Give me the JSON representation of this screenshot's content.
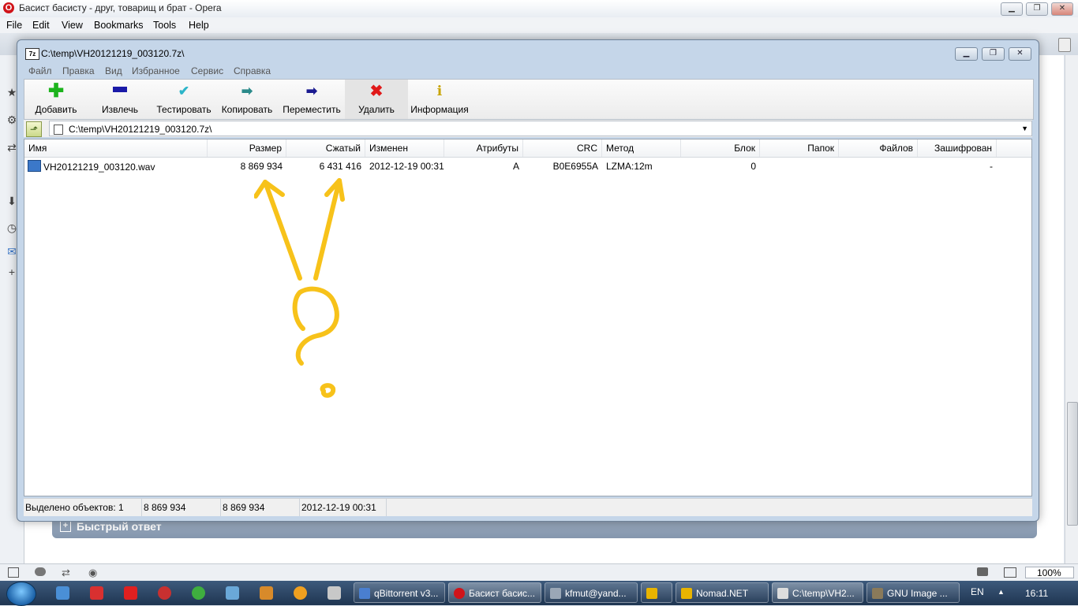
{
  "opera": {
    "title": "Басист басисту - друг, товарищ и брат - Opera",
    "menu": [
      "File",
      "Edit",
      "View",
      "Bookmarks",
      "Tools",
      "Help"
    ],
    "quick_reply": "Быстрый ответ",
    "zoom": "100%"
  },
  "zip": {
    "title": "C:\\temp\\VH20121219_003120.7z\\",
    "menu": [
      "Файл",
      "Правка",
      "Вид",
      "Избранное",
      "Сервис",
      "Справка"
    ],
    "toolbar": [
      {
        "label": "Добавить",
        "icon": "plus-icon",
        "color": "#1db31d"
      },
      {
        "label": "Извлечь",
        "icon": "minus-icon",
        "color": "#1a1aa8"
      },
      {
        "label": "Тестировать",
        "icon": "check-icon",
        "color": "#2cb5c9"
      },
      {
        "label": "Копировать",
        "icon": "copy-arrow-icon",
        "color": "#2a8a8a"
      },
      {
        "label": "Переместить",
        "icon": "move-arrow-icon",
        "color": "#1a1a90"
      },
      {
        "label": "Удалить",
        "icon": "delete-x-icon",
        "color": "#e01818"
      },
      {
        "label": "Информация",
        "icon": "info-icon",
        "color": "#c8a400"
      }
    ],
    "address": "C:\\temp\\VH20121219_003120.7z\\",
    "columns": [
      "Имя",
      "Размер",
      "Сжатый",
      "Изменен",
      "Атрибуты",
      "CRC",
      "Метод",
      "Блок",
      "Папок",
      "Файлов",
      "Зашифрован"
    ],
    "rows": [
      {
        "name": "VH20121219_003120.wav",
        "size": "8 869 934",
        "packed": "6 431 416",
        "modified": "2012-12-19 00:31",
        "attributes": "A",
        "crc": "B0E6955A",
        "method": "LZMA:12m",
        "block": "0",
        "folders": "",
        "files": "",
        "encrypted": "-"
      }
    ],
    "status": {
      "selected": "Выделено объектов: 1",
      "size": "8 869 934",
      "packed": "8 869 934",
      "modified": "2012-12-19 00:31"
    },
    "annotation_color": "#f7c21a"
  },
  "taskbar": {
    "tasks": [
      {
        "label": "qBittorrent v3...",
        "color": "#4a7fcf"
      },
      {
        "label": "Басист басис...",
        "color": "#d0141a",
        "active": true
      },
      {
        "label": "kfmut@yand...",
        "color": "#9aa7b6"
      },
      {
        "label": "",
        "color": "#e8b400"
      },
      {
        "label": "Nomad.NET",
        "color": "#e8b400"
      },
      {
        "label": "C:\\temp\\VH2...",
        "color": "#dddddd",
        "active": true
      },
      {
        "label": "GNU Image ...",
        "color": "#8a7a5a"
      }
    ],
    "lang": "EN",
    "time": "16:11"
  }
}
